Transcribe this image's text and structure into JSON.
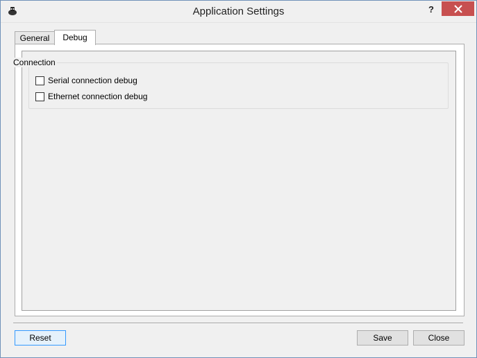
{
  "window": {
    "title": "Application Settings",
    "help_glyph": "?",
    "close_glyph": "✕"
  },
  "tabs": [
    {
      "label": "General",
      "active": false
    },
    {
      "label": "Debug",
      "active": true
    }
  ],
  "debug": {
    "group_title": "Connection",
    "options": [
      {
        "label": "Serial connection debug",
        "checked": false
      },
      {
        "label": "Ethernet connection debug",
        "checked": false
      }
    ]
  },
  "footer": {
    "reset_label": "Reset",
    "save_label": "Save",
    "close_label": "Close"
  },
  "colors": {
    "close_button": "#c75050",
    "focus_border": "#3399ff"
  },
  "icons": {
    "app": "app-icon",
    "close": "close-icon",
    "help": "help-icon",
    "checkbox": "checkbox-icon"
  }
}
